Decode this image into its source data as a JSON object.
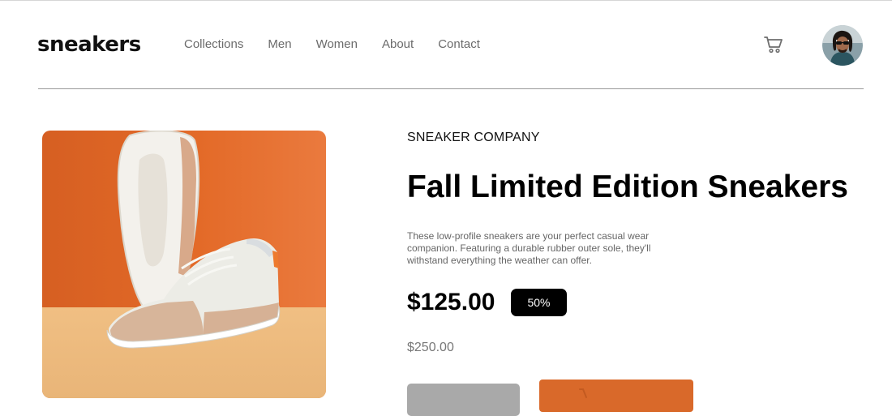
{
  "header": {
    "logo": "sneakers",
    "nav": [
      "Collections",
      "Men",
      "Women",
      "About",
      "Contact"
    ],
    "cart_icon": "cart-icon",
    "avatar_icon": "user-avatar"
  },
  "product": {
    "company": "SNEAKER COMPANY",
    "title": "Fall Limited Edition Sneakers",
    "description": "These low-profile sneakers are your perfect casual wear companion. Featuring a durable rubber outer sole, they'll withstand everything the weather can offer.",
    "price": "$125.00",
    "discount": "50%",
    "original_price": "$250.00"
  },
  "colors": {
    "accent": "#d9692a",
    "image_bg": "#e0692a",
    "floor": "#eec087"
  }
}
